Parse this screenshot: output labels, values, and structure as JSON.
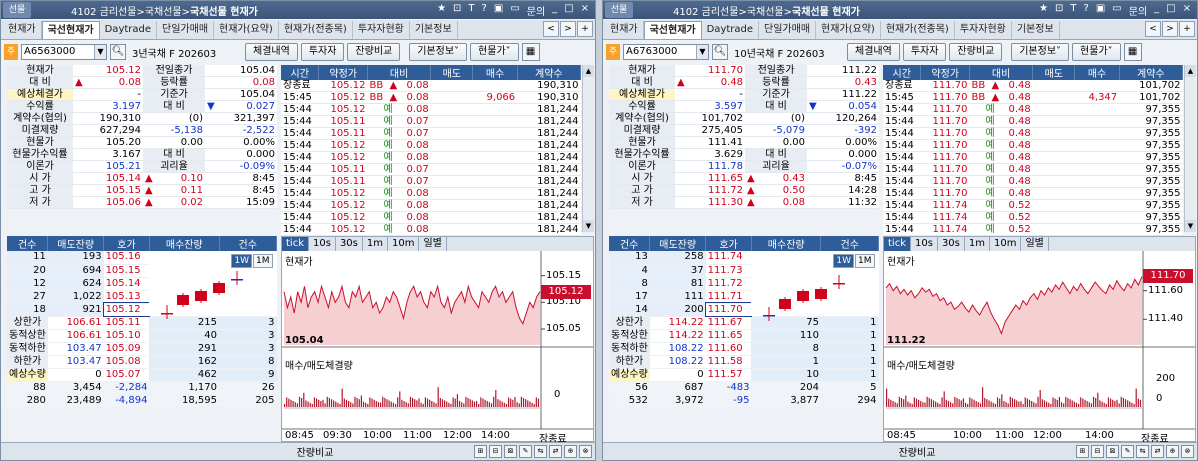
{
  "common": {
    "title_prefix": "4102 금리선물>국채선물>",
    "title_bold": "국채선물 현재가",
    "logo": "선물",
    "title_ctrls": [
      "★",
      "⊡",
      "T",
      "?",
      "▣",
      "▭",
      "문의",
      "_",
      "□",
      "×"
    ],
    "tabs": [
      "현재가",
      "국선현재가",
      "Daytrade",
      "단일가매매",
      "현재가(요약)",
      "현재가(전종목)",
      "투자자현황",
      "기본정보"
    ],
    "tabnav": [
      "<",
      ">",
      "+"
    ],
    "jcode_label": "주",
    "buttons": [
      "체결내역",
      "투자자",
      "잔량비교",
      "기본정보˅",
      "현물가˅"
    ],
    "info_labels": [
      "현재가",
      "대 비",
      "예상체결가",
      "수익률",
      "계약수(협의)",
      "미결제량",
      "현물가",
      "현물가수익률",
      "이론가",
      "시 가",
      "고 가",
      "저 가"
    ],
    "info_labels2": [
      "전일종가",
      "등락률",
      "기준가",
      "대 비",
      "",
      "",
      "",
      "대 비",
      "괴리율",
      "",
      "",
      ""
    ],
    "tick_headers": [
      "시간",
      "약정가",
      "대비",
      "매도",
      "매수",
      "계약수"
    ],
    "hoga_headers": [
      "건수",
      "매도잔량",
      "호가",
      "매수잔량",
      "건수"
    ],
    "hoga_labels": [
      "상한가",
      "동적상한",
      "동적하한",
      "하한가",
      "예상수량"
    ],
    "chart_tabs": [
      "tick",
      "10s",
      "30s",
      "1m",
      "10m",
      "일별"
    ],
    "chart_periods": [
      "1W",
      "1M"
    ],
    "chart_label_price": "현재가",
    "chart_label_vol": "매수/매도체결량",
    "status_compare": "잔량비교",
    "status_icons": [
      "⊞",
      "⊟",
      "⊠",
      "✎",
      "⇆",
      "⇄",
      "⊕",
      "⊗"
    ]
  },
  "panels": [
    {
      "code": "A6563000",
      "name": "3년국채 F 202603",
      "info": {
        "price": "105.12",
        "prev_close": "105.04",
        "change": "0.08",
        "change_rate": "0.08",
        "exp_price": "-",
        "base_price": "105.04",
        "yield": "3.197",
        "yield_chg": "0.027",
        "contracts": "190,310",
        "contracts_nego": "(0)",
        "contracts3": "321,397",
        "oi": "627,294",
        "oi_chg": "-5,138",
        "oi_chg2": "-2,522",
        "spot": "105.20",
        "spot2": "0.00",
        "spot_rate": "0.00%",
        "spot_yield": "3.167",
        "spot_yield_chg": "0.000",
        "theory": "105.21",
        "disparity": "-0.09%",
        "open": "105.14",
        "open_chg": "0.10",
        "open_time": "8:45",
        "high": "105.15",
        "high_chg": "0.11",
        "high_time": "8:45",
        "low": "105.06",
        "low_chg": "0.02",
        "low_time": "15:09"
      },
      "ticks": [
        {
          "t": "장종료",
          "p": "105.12",
          "f": "BB",
          "c": "0.08",
          "s": "",
          "b": "",
          "q": "190,310",
          "up": true
        },
        {
          "t": "15:45",
          "p": "105.12",
          "f": "BB",
          "c": "0.08",
          "s": "",
          "b": "9,066",
          "q": "190,310",
          "up": true
        },
        {
          "t": "15:44",
          "p": "105.12",
          "f": "예",
          "c": "0.08",
          "s": "",
          "b": "",
          "q": "181,244",
          "up": false
        },
        {
          "t": "15:44",
          "p": "105.11",
          "f": "예",
          "c": "0.07",
          "s": "",
          "b": "",
          "q": "181,244",
          "up": false
        },
        {
          "t": "15:44",
          "p": "105.11",
          "f": "예",
          "c": "0.07",
          "s": "",
          "b": "",
          "q": "181,244",
          "up": false
        },
        {
          "t": "15:44",
          "p": "105.12",
          "f": "예",
          "c": "0.08",
          "s": "",
          "b": "",
          "q": "181,244",
          "up": false
        },
        {
          "t": "15:44",
          "p": "105.12",
          "f": "예",
          "c": "0.08",
          "s": "",
          "b": "",
          "q": "181,244",
          "up": false
        },
        {
          "t": "15:44",
          "p": "105.11",
          "f": "예",
          "c": "0.07",
          "s": "",
          "b": "",
          "q": "181,244",
          "up": false
        },
        {
          "t": "15:44",
          "p": "105.11",
          "f": "예",
          "c": "0.07",
          "s": "",
          "b": "",
          "q": "181,244",
          "up": false
        },
        {
          "t": "15:44",
          "p": "105.12",
          "f": "예",
          "c": "0.08",
          "s": "",
          "b": "",
          "q": "181,244",
          "up": false
        },
        {
          "t": "15:44",
          "p": "105.12",
          "f": "예",
          "c": "0.08",
          "s": "",
          "b": "",
          "q": "181,244",
          "up": false
        },
        {
          "t": "15:44",
          "p": "105.12",
          "f": "예",
          "c": "0.08",
          "s": "",
          "b": "",
          "q": "181,244",
          "up": false
        },
        {
          "t": "15:44",
          "p": "105.12",
          "f": "예",
          "c": "0.08",
          "s": "",
          "b": "",
          "q": "181,244",
          "up": false
        }
      ],
      "asks": [
        {
          "n": "11",
          "q": "193",
          "p": "105.16"
        },
        {
          "n": "20",
          "q": "694",
          "p": "105.15"
        },
        {
          "n": "12",
          "q": "624",
          "p": "105.14"
        },
        {
          "n": "27",
          "q": "1,022",
          "p": "105.13"
        },
        {
          "n": "18",
          "q": "921",
          "p": "105.12"
        }
      ],
      "bids": [
        {
          "lbl": "106.61",
          "p": "105.11",
          "q": "215",
          "n": "3"
        },
        {
          "lbl": "106.61",
          "p": "105.10",
          "q": "40",
          "n": "3"
        },
        {
          "lbl": "103.47",
          "p": "105.09",
          "q": "291",
          "n": "3"
        },
        {
          "lbl": "103.47",
          "p": "105.08",
          "q": "162",
          "n": "8"
        },
        {
          "lbl": "0",
          "p": "105.07",
          "q": "462",
          "n": "9"
        }
      ],
      "totals": [
        {
          "a": "88",
          "b": "3,454",
          "c": "-2,284",
          "d": "1,170",
          "e": "26"
        },
        {
          "a": "280",
          "b": "23,489",
          "c": "-4,894",
          "d": "18,595",
          "e": "205"
        }
      ],
      "axis": [
        "105.15",
        "105.10",
        "105.05"
      ],
      "axis_vol": [
        "0"
      ],
      "cur_badge": "105.12",
      "low_label": "105.04",
      "time_axis": [
        "08:45",
        "09:30",
        "10:00",
        "11:00",
        "12:00",
        "14:00",
        "장종료"
      ],
      "chart_data": {
        "type": "line",
        "title": "현재가",
        "ylim": [
          105.02,
          105.17
        ],
        "yticks": [
          105.15,
          105.1,
          105.05
        ],
        "values": [
          105.12,
          105.09,
          105.11,
          105.08,
          105.12,
          105.1,
          105.13,
          105.09,
          105.11,
          105.12,
          105.1,
          105.13,
          105.11,
          105.09,
          105.12,
          105.1,
          105.11,
          105.13,
          105.1,
          105.09,
          105.12,
          105.11,
          105.13,
          105.1,
          105.11,
          105.12,
          105.09,
          105.1,
          105.08,
          105.09,
          105.11,
          105.1,
          105.12,
          105.11,
          105.09,
          105.07,
          105.1,
          105.12,
          105.13,
          105.11,
          105.12,
          105.1,
          105.09,
          105.12,
          105.11,
          105.13,
          105.1,
          105.09,
          105.11,
          105.08,
          105.1,
          105.11,
          105.12,
          105.1,
          105.13,
          105.11,
          105.1,
          105.09,
          105.12,
          105.11,
          105.1,
          105.12,
          105.13,
          105.11,
          105.12,
          105.1,
          105.11,
          105.12,
          105.09,
          105.07,
          105.06,
          105.08,
          105.1,
          105.09,
          105.11,
          105.12
        ]
      }
    },
    {
      "code": "A6763000",
      "name": "10년국채 F 202603",
      "info": {
        "price": "111.70",
        "prev_close": "111.22",
        "change": "0.48",
        "change_rate": "0.43",
        "exp_price": "-",
        "base_price": "111.22",
        "yield": "3.597",
        "yield_chg": "0.054",
        "contracts": "101,702",
        "contracts_nego": "(0)",
        "contracts3": "120,264",
        "oi": "275,405",
        "oi_chg": "-5,079",
        "oi_chg2": "-392",
        "spot": "111.41",
        "spot2": "0.00",
        "spot_rate": "0.00%",
        "spot_yield": "3.629",
        "spot_yield_chg": "0.000",
        "theory": "111.78",
        "disparity": "-0.07%",
        "open": "111.65",
        "open_chg": "0.43",
        "open_time": "8:45",
        "high": "111.72",
        "high_chg": "0.50",
        "high_time": "14:28",
        "low": "111.30",
        "low_chg": "0.08",
        "low_time": "11:32"
      },
      "ticks": [
        {
          "t": "장종료",
          "p": "111.70",
          "f": "BB",
          "c": "0.48",
          "s": "",
          "b": "",
          "q": "101,702",
          "up": true
        },
        {
          "t": "15:45",
          "p": "111.70",
          "f": "BB",
          "c": "0.48",
          "s": "",
          "b": "4,347",
          "q": "101,702",
          "up": true
        },
        {
          "t": "15:44",
          "p": "111.70",
          "f": "예",
          "c": "0.48",
          "s": "",
          "b": "",
          "q": "97,355",
          "up": false
        },
        {
          "t": "15:44",
          "p": "111.70",
          "f": "예",
          "c": "0.48",
          "s": "",
          "b": "",
          "q": "97,355",
          "up": false
        },
        {
          "t": "15:44",
          "p": "111.70",
          "f": "예",
          "c": "0.48",
          "s": "",
          "b": "",
          "q": "97,355",
          "up": false
        },
        {
          "t": "15:44",
          "p": "111.70",
          "f": "예",
          "c": "0.48",
          "s": "",
          "b": "",
          "q": "97,355",
          "up": false
        },
        {
          "t": "15:44",
          "p": "111.70",
          "f": "예",
          "c": "0.48",
          "s": "",
          "b": "",
          "q": "97,355",
          "up": false
        },
        {
          "t": "15:44",
          "p": "111.70",
          "f": "예",
          "c": "0.48",
          "s": "",
          "b": "",
          "q": "97,355",
          "up": false
        },
        {
          "t": "15:44",
          "p": "111.70",
          "f": "예",
          "c": "0.48",
          "s": "",
          "b": "",
          "q": "97,355",
          "up": false
        },
        {
          "t": "15:44",
          "p": "111.70",
          "f": "예",
          "c": "0.48",
          "s": "",
          "b": "",
          "q": "97,355",
          "up": false
        },
        {
          "t": "15:44",
          "p": "111.74",
          "f": "예",
          "c": "0.52",
          "s": "",
          "b": "",
          "q": "97,355",
          "up": false
        },
        {
          "t": "15:44",
          "p": "111.74",
          "f": "예",
          "c": "0.52",
          "s": "",
          "b": "",
          "q": "97,355",
          "up": false
        },
        {
          "t": "15:44",
          "p": "111.74",
          "f": "예",
          "c": "0.52",
          "s": "",
          "b": "",
          "q": "97,355",
          "up": false
        }
      ],
      "asks": [
        {
          "n": "13",
          "q": "258",
          "p": "111.74"
        },
        {
          "n": "4",
          "q": "37",
          "p": "111.73"
        },
        {
          "n": "8",
          "q": "81",
          "p": "111.72"
        },
        {
          "n": "17",
          "q": "111",
          "p": "111.71"
        },
        {
          "n": "14",
          "q": "200",
          "p": "111.70"
        }
      ],
      "bids": [
        {
          "lbl": "114.22",
          "p": "111.67",
          "q": "75",
          "n": "1"
        },
        {
          "lbl": "114.22",
          "p": "111.65",
          "q": "110",
          "n": "1"
        },
        {
          "lbl": "108.22",
          "p": "111.60",
          "q": "8",
          "n": "1"
        },
        {
          "lbl": "108.22",
          "p": "111.58",
          "q": "1",
          "n": "1"
        },
        {
          "lbl": "0",
          "p": "111.57",
          "q": "10",
          "n": "1"
        }
      ],
      "totals": [
        {
          "a": "56",
          "b": "687",
          "c": "-483",
          "d": "204",
          "e": "5"
        },
        {
          "a": "532",
          "b": "3,972",
          "c": "-95",
          "d": "3,877",
          "e": "294"
        }
      ],
      "axis": [
        "111.60",
        "111.40"
      ],
      "axis_vol": [
        "200",
        "0"
      ],
      "cur_badge": "111.70",
      "low_label": "111.22",
      "time_axis": [
        "08:45",
        "10:00",
        "11:00",
        "12:00",
        "14:00",
        "장종료"
      ],
      "chart_data": {
        "type": "line",
        "title": "현재가",
        "ylim": [
          111.22,
          111.78
        ],
        "yticks": [
          111.6,
          111.4
        ],
        "values": [
          111.62,
          111.65,
          111.6,
          111.63,
          111.58,
          111.61,
          111.57,
          111.6,
          111.55,
          111.58,
          111.62,
          111.59,
          111.61,
          111.56,
          111.58,
          111.53,
          111.55,
          111.5,
          111.52,
          111.47,
          111.49,
          111.52,
          111.48,
          111.45,
          111.5,
          111.46,
          111.43,
          111.48,
          111.52,
          111.45,
          111.4,
          111.36,
          111.3,
          111.38,
          111.42,
          111.46,
          111.5,
          111.47,
          111.53,
          111.5,
          111.55,
          111.58,
          111.54,
          111.6,
          111.57,
          111.62,
          111.59,
          111.64,
          111.61,
          111.66,
          111.62,
          111.58,
          111.63,
          111.6,
          111.65,
          111.61,
          111.58,
          111.62,
          111.66,
          111.63,
          111.6,
          111.58,
          111.64,
          111.61,
          111.67,
          111.63,
          111.6,
          111.65,
          111.62,
          111.68,
          111.64,
          111.7
        ]
      }
    }
  ]
}
